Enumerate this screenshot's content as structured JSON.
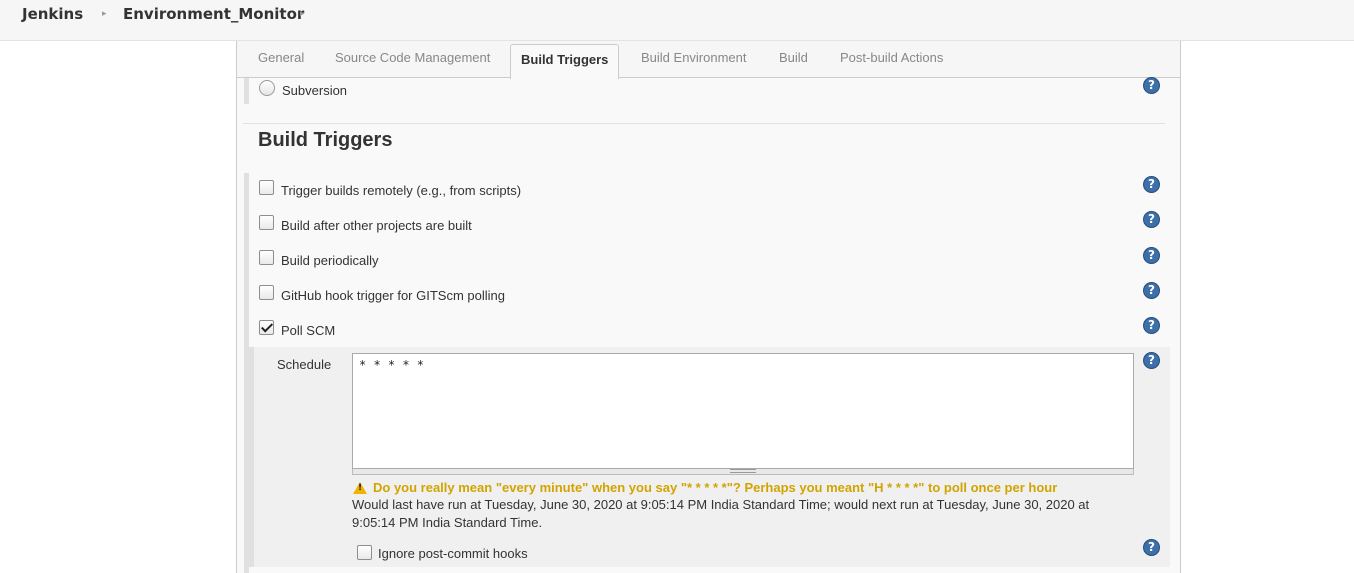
{
  "breadcrumb": {
    "items": [
      "Jenkins",
      "Environment_Monitor"
    ],
    "separator": "▸"
  },
  "tabs": [
    {
      "label": "General",
      "active": false
    },
    {
      "label": "Source Code Management",
      "active": false
    },
    {
      "label": "Build Triggers",
      "active": true
    },
    {
      "label": "Build Environment",
      "active": false
    },
    {
      "label": "Build",
      "active": false
    },
    {
      "label": "Post-build Actions",
      "active": false
    }
  ],
  "scm": {
    "subversion_label": "Subversion",
    "subversion_selected": false
  },
  "build_triggers": {
    "heading": "Build Triggers",
    "options": [
      {
        "label": "Trigger builds remotely (e.g., from scripts)",
        "checked": false
      },
      {
        "label": "Build after other projects are built",
        "checked": false
      },
      {
        "label": "Build periodically",
        "checked": false
      },
      {
        "label": "GitHub hook trigger for GITScm polling",
        "checked": false
      },
      {
        "label": "Poll SCM",
        "checked": true
      }
    ],
    "schedule": {
      "label": "Schedule",
      "value": "* * * * *",
      "warning": "Do you really mean \"every minute\" when you say \"* * * * *\"? Perhaps you meant \"H * * * *\" to poll once per hour",
      "info": "Would last have run at Tuesday, June 30, 2020 at 9:05:14 PM India Standard Time; would next run at Tuesday, June 30, 2020 at 9:05:14 PM India Standard Time."
    },
    "ignore_hooks": {
      "label": "Ignore post-commit hooks",
      "checked": false
    }
  },
  "help_glyph": "?",
  "warning_glyph": "!",
  "colors": {
    "accent": "#3d6fa8",
    "warning": "#d2a400",
    "panel": "#f9f9f9"
  }
}
